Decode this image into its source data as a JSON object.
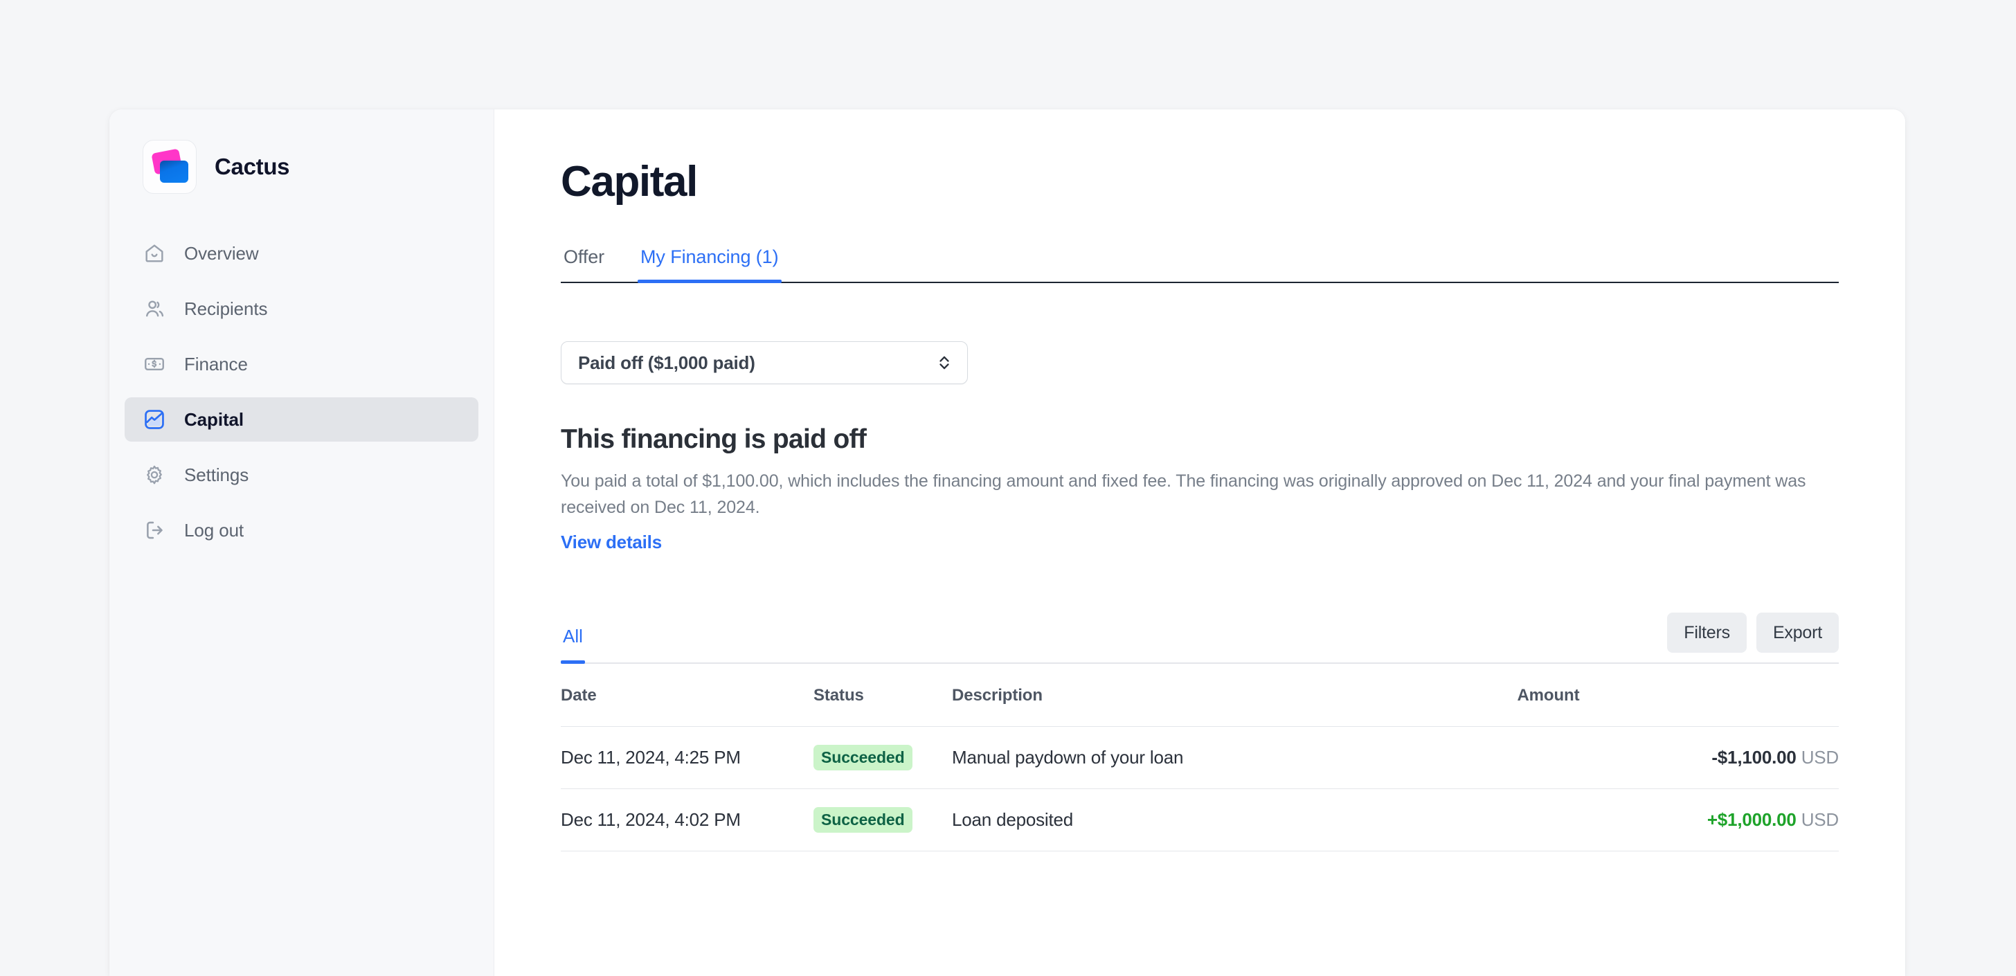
{
  "brand": {
    "name": "Cactus",
    "logo_icon": "cactus-logo-icon",
    "logo_pink": "#ff36c8",
    "logo_blue": "#0d7ff2"
  },
  "sidebar": {
    "items": [
      {
        "label": "Overview",
        "icon": "home-icon",
        "active": false
      },
      {
        "label": "Recipients",
        "icon": "people-icon",
        "active": false
      },
      {
        "label": "Finance",
        "icon": "banknote-icon",
        "active": false
      },
      {
        "label": "Capital",
        "icon": "chart-box-icon",
        "active": true
      },
      {
        "label": "Settings",
        "icon": "gear-icon",
        "active": false
      },
      {
        "label": "Log out",
        "icon": "logout-icon",
        "active": false
      }
    ]
  },
  "page": {
    "title": "Capital"
  },
  "tabs": [
    {
      "label": "Offer",
      "active": false
    },
    {
      "label": "My Financing (1)",
      "active": true
    }
  ],
  "financing_select": {
    "value": "Paid off ($1,000 paid)",
    "chevron_icon": "chevron-up-down-icon"
  },
  "paid_off": {
    "heading": "This financing is paid off",
    "description": "You paid a total of $1,100.00, which includes the financing amount and fixed fee. The financing was originally approved on Dec 11, 2024 and your final payment was received on Dec 11, 2024.",
    "link": "View details"
  },
  "transactions_toolbar": {
    "tabs": [
      {
        "label": "All",
        "active": true
      }
    ],
    "filters_label": "Filters",
    "export_label": "Export"
  },
  "table": {
    "columns": [
      "Date",
      "Status",
      "Description",
      "Amount"
    ],
    "rows": [
      {
        "date": "Dec 11, 2024, 4:25 PM",
        "status": "Succeeded",
        "description": "Manual paydown of your loan",
        "amount": "-$1,100.00",
        "currency": "USD",
        "sign": "neg"
      },
      {
        "date": "Dec 11, 2024, 4:02 PM",
        "status": "Succeeded",
        "description": "Loan deposited",
        "amount": "+$1,000.00",
        "currency": "USD",
        "sign": "pos"
      }
    ]
  },
  "colors": {
    "accent_blue": "#2c6ff5",
    "badge_bg": "#cbf4c9",
    "badge_text": "#0e6245",
    "amount_positive": "#1ea32a",
    "sidebar_bg": "#f7f8fa",
    "sidebar_active_bg": "#e2e4e8",
    "page_bg": "#f5f6f8"
  }
}
